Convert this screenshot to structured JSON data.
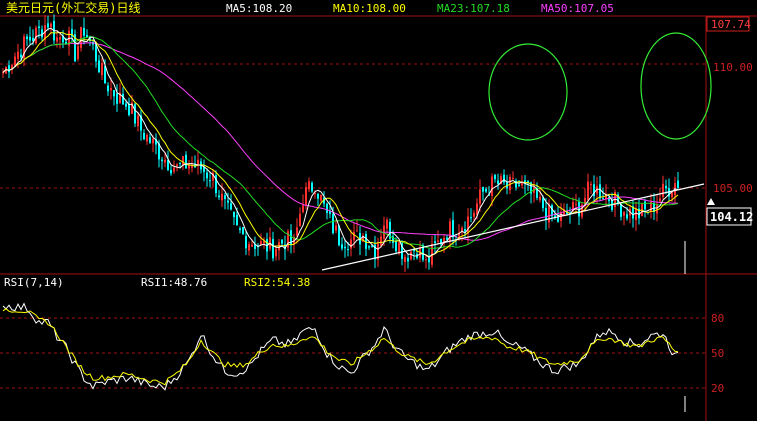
{
  "window": {
    "title": "美元日元(外汇交易)日线"
  },
  "price_panel": {
    "ma_readouts": [
      {
        "label": "MA5:108.20",
        "color": "#ffffff"
      },
      {
        "label": "MA10:108.00",
        "color": "#ffff00"
      },
      {
        "label": "MA23:107.18",
        "color": "#22dd22"
      },
      {
        "label": "MA50:107.05",
        "color": "#ff40ff"
      }
    ],
    "ticks": [
      "110.00",
      "105.00"
    ],
    "top_value": "107.74",
    "current_price": "104.12"
  },
  "rsi_panel": {
    "title": "RSI(7,14)",
    "readouts": [
      {
        "label": "RSI1:48.76",
        "color": "#ffffff"
      },
      {
        "label": "RSI2:54.38",
        "color": "#ffff00"
      }
    ],
    "ticks": [
      "80",
      "50",
      "20"
    ]
  },
  "colors": {
    "up_candle": "#ff3030",
    "down_candle": "#00ffff",
    "grid": "#a01010",
    "trendline": "#ffffff",
    "ellipse": "#33ee33"
  },
  "chart_data": {
    "type": "line",
    "price_range": [
      101.8,
      112.5
    ],
    "rsi_range": [
      0,
      100
    ],
    "close_anchors": [
      [
        0,
        110.2
      ],
      [
        4,
        110.9
      ],
      [
        8,
        111.5
      ],
      [
        12,
        111.9
      ],
      [
        15,
        112.3
      ],
      [
        18,
        111.6
      ],
      [
        21,
        111.8
      ],
      [
        24,
        111.0
      ],
      [
        27,
        112.0
      ],
      [
        30,
        111.2
      ],
      [
        34,
        109.8
      ],
      [
        38,
        109.2
      ],
      [
        42,
        108.8
      ],
      [
        46,
        107.8
      ],
      [
        50,
        107.2
      ],
      [
        54,
        106.6
      ],
      [
        58,
        106.2
      ],
      [
        62,
        106.4
      ],
      [
        66,
        106.2
      ],
      [
        70,
        105.8
      ],
      [
        74,
        104.6
      ],
      [
        78,
        103.6
      ],
      [
        82,
        103.2
      ],
      [
        86,
        103.0
      ],
      [
        90,
        102.9
      ],
      [
        94,
        103.2
      ],
      [
        97,
        103.0
      ],
      [
        100,
        105.0
      ],
      [
        104,
        105.6
      ],
      [
        108,
        104.2
      ],
      [
        112,
        103.3
      ],
      [
        116,
        103.2
      ],
      [
        120,
        103.4
      ],
      [
        124,
        102.8
      ],
      [
        127,
        104.0
      ],
      [
        130,
        103.4
      ],
      [
        134,
        102.6
      ],
      [
        138,
        102.9
      ],
      [
        141,
        102.2
      ],
      [
        144,
        102.9
      ],
      [
        148,
        103.6
      ],
      [
        152,
        103.8
      ],
      [
        156,
        104.2
      ],
      [
        160,
        105.2
      ],
      [
        164,
        105.6
      ],
      [
        168,
        105.4
      ],
      [
        172,
        105.5
      ],
      [
        176,
        105.1
      ],
      [
        180,
        104.6
      ],
      [
        184,
        104.0
      ],
      [
        188,
        104.3
      ],
      [
        192,
        104.6
      ],
      [
        196,
        105.4
      ],
      [
        200,
        105.2
      ],
      [
        204,
        104.8
      ],
      [
        208,
        104.4
      ],
      [
        212,
        104.3
      ],
      [
        216,
        104.5
      ],
      [
        220,
        105.2
      ],
      [
        224,
        105.6
      ]
    ],
    "rsi1": [
      [
        0,
        95
      ],
      [
        4,
        94
      ],
      [
        8,
        93
      ],
      [
        12,
        80
      ],
      [
        15,
        80
      ],
      [
        18,
        67
      ],
      [
        21,
        57
      ],
      [
        24,
        42
      ],
      [
        27,
        30
      ],
      [
        30,
        22
      ],
      [
        34,
        26
      ],
      [
        38,
        28
      ],
      [
        42,
        30
      ],
      [
        46,
        26
      ],
      [
        50,
        22
      ],
      [
        54,
        22
      ],
      [
        58,
        32
      ],
      [
        62,
        45
      ],
      [
        66,
        70
      ],
      [
        70,
        50
      ],
      [
        74,
        36
      ],
      [
        78,
        34
      ],
      [
        82,
        40
      ],
      [
        86,
        54
      ],
      [
        90,
        64
      ],
      [
        94,
        60
      ],
      [
        97,
        62
      ],
      [
        100,
        72
      ],
      [
        104,
        74
      ],
      [
        108,
        52
      ],
      [
        112,
        40
      ],
      [
        116,
        34
      ],
      [
        120,
        48
      ],
      [
        124,
        60
      ],
      [
        127,
        74
      ],
      [
        130,
        60
      ],
      [
        134,
        48
      ],
      [
        138,
        42
      ],
      [
        141,
        36
      ],
      [
        144,
        42
      ],
      [
        148,
        54
      ],
      [
        152,
        62
      ],
      [
        156,
        68
      ],
      [
        160,
        70
      ],
      [
        164,
        72
      ],
      [
        168,
        60
      ],
      [
        172,
        58
      ],
      [
        176,
        50
      ],
      [
        180,
        42
      ],
      [
        184,
        36
      ],
      [
        188,
        40
      ],
      [
        192,
        42
      ],
      [
        196,
        60
      ],
      [
        200,
        72
      ],
      [
        204,
        70
      ],
      [
        208,
        62
      ],
      [
        212,
        60
      ],
      [
        216,
        68
      ],
      [
        220,
        70
      ],
      [
        224,
        49
      ]
    ],
    "rsi2": [
      [
        0,
        92
      ],
      [
        4,
        91
      ],
      [
        8,
        90
      ],
      [
        12,
        82
      ],
      [
        15,
        80
      ],
      [
        18,
        70
      ],
      [
        21,
        58
      ],
      [
        24,
        46
      ],
      [
        27,
        36
      ],
      [
        30,
        30
      ],
      [
        34,
        30
      ],
      [
        38,
        32
      ],
      [
        42,
        33
      ],
      [
        46,
        30
      ],
      [
        50,
        27
      ],
      [
        54,
        26
      ],
      [
        58,
        34
      ],
      [
        62,
        45
      ],
      [
        66,
        64
      ],
      [
        70,
        52
      ],
      [
        74,
        42
      ],
      [
        78,
        40
      ],
      [
        82,
        44
      ],
      [
        86,
        54
      ],
      [
        90,
        60
      ],
      [
        94,
        58
      ],
      [
        97,
        60
      ],
      [
        100,
        66
      ],
      [
        104,
        66
      ],
      [
        108,
        54
      ],
      [
        112,
        46
      ],
      [
        116,
        42
      ],
      [
        120,
        50
      ],
      [
        124,
        58
      ],
      [
        127,
        66
      ],
      [
        130,
        58
      ],
      [
        134,
        50
      ],
      [
        138,
        46
      ],
      [
        141,
        42
      ],
      [
        144,
        46
      ],
      [
        148,
        54
      ],
      [
        152,
        60
      ],
      [
        156,
        64
      ],
      [
        160,
        66
      ],
      [
        164,
        66
      ],
      [
        168,
        58
      ],
      [
        172,
        56
      ],
      [
        176,
        52
      ],
      [
        180,
        46
      ],
      [
        184,
        42
      ],
      [
        188,
        44
      ],
      [
        192,
        46
      ],
      [
        196,
        58
      ],
      [
        200,
        66
      ],
      [
        204,
        64
      ],
      [
        208,
        60
      ],
      [
        212,
        58
      ],
      [
        216,
        64
      ],
      [
        220,
        66
      ],
      [
        224,
        54
      ]
    ]
  }
}
